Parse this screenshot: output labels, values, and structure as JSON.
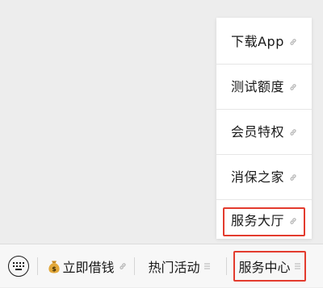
{
  "popup_menu": {
    "items": [
      {
        "label": "下载App",
        "icon": "link-icon"
      },
      {
        "label": "测试额度",
        "icon": "link-icon"
      },
      {
        "label": "会员特权",
        "icon": "link-icon"
      },
      {
        "label": "消保之家",
        "icon": "link-icon"
      },
      {
        "label": "服务大厅",
        "icon": "link-icon",
        "highlighted": true
      }
    ]
  },
  "bottom_bar": {
    "keyboard_icon": "keyboard-icon",
    "tabs": [
      {
        "label": "立即借钱",
        "leading_icon": "money-bag-icon",
        "trailing_icon": "link-icon"
      },
      {
        "label": "热门活动",
        "trailing_icon": "menu-icon"
      },
      {
        "label": "服务中心",
        "trailing_icon": "menu-icon",
        "highlighted": true
      }
    ]
  },
  "colors": {
    "background": "#ededed",
    "bar_background": "#f7f7f7",
    "highlight_border": "#e33b2e",
    "text": "#191919",
    "icon_gray": "#b2b2b2"
  }
}
